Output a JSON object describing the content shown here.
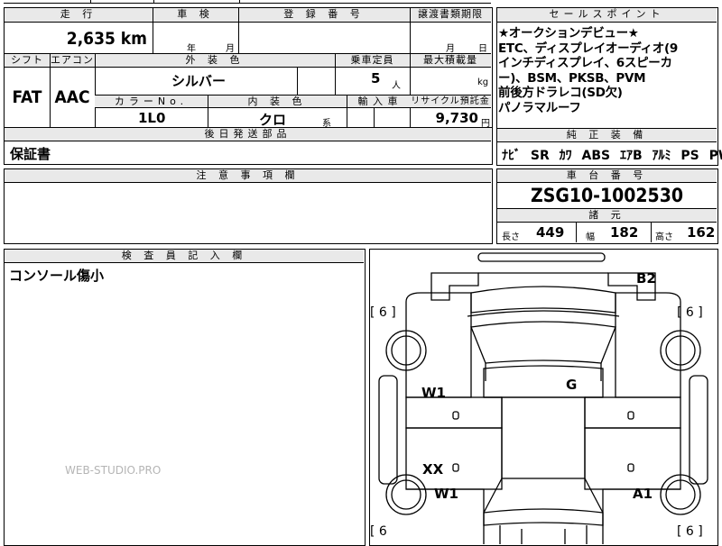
{
  "top": {
    "mileage_header": "走 行",
    "mileage_value": "2,635 km",
    "inspection_header": "車 検",
    "inspection_year": "年",
    "inspection_month": "月",
    "registration_header": "登 録 番 号",
    "transfer_header": "譲渡書類期限",
    "transfer_month": "月",
    "transfer_day": "日"
  },
  "spec": {
    "shift_header": "シフト",
    "shift_value": "FAT",
    "aircon_header": "エアコン",
    "aircon_value": "AAC",
    "exterior_color_header": "外 装 色",
    "exterior_color_value": "シルバー",
    "capacity_header": "乗車定員",
    "capacity_value": "5",
    "capacity_unit": "人",
    "load_header": "最大積載量",
    "load_unit": "kg",
    "color_no_header": "カラーNo.",
    "color_no_value": "1L0",
    "interior_header": "内 装 色",
    "interior_value": "クロ",
    "interior_suffix": "系",
    "import_header": "輸 入 車",
    "recycle_header": "リサイクル預託金",
    "recycle_value": "9,730",
    "recycle_unit": "円"
  },
  "later_parts": {
    "header": "後日発送部品",
    "value": "保証書"
  },
  "notes": {
    "header": "注 意 事 項 欄"
  },
  "sales_points": {
    "header": "セールスポイント",
    "lines": [
      "★オークションデビュー★",
      "ETC、ディスプレイオーディオ(9",
      "インチディスプレイ、6スピーカ",
      "ー)、BSM、PKSB、PVM",
      "前後方ドラレコ(SD欠)",
      "パノラマルーフ"
    ]
  },
  "equipment": {
    "header": "純 正 装 備",
    "items": [
      "ﾅﾋﾞ",
      "SR",
      "ｶﾜ",
      "ABS",
      "ｴｱB",
      "ｱﾙﾐ",
      "PS",
      "PW"
    ]
  },
  "chassis": {
    "header": "車 台 番 号",
    "value": "ZSG10-1002530"
  },
  "dimensions": {
    "header": "諸 元",
    "length_label": "長さ",
    "length_value": "449",
    "width_label": "幅",
    "width_value": "182",
    "height_label": "高さ",
    "height_value": "162"
  },
  "inspector": {
    "header": "検 査 員 記 入 欄",
    "value": "コンソール傷小"
  },
  "diagram": {
    "marks": {
      "b2": "B2",
      "w1_left_upper": "W1",
      "g": "G",
      "xx": "XX",
      "w1_left_lower": "W1",
      "a1": "A1"
    },
    "tire_left_front": "[ 6 ]",
    "tire_right_front": "[ 6 ]",
    "tire_left_rear": "[ 6",
    "tire_right_rear": "[ 6 ]"
  },
  "watermark": "WEB-STUDIO.PRO"
}
